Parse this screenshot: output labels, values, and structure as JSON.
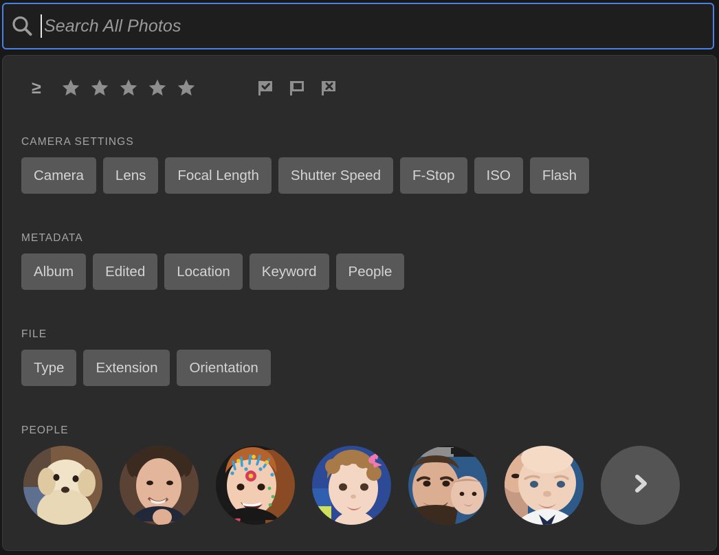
{
  "search": {
    "placeholder": "Search All Photos",
    "value": "",
    "icon": "search-icon"
  },
  "rating_filter": {
    "operator": "≥",
    "star_count": 5,
    "stars_selected": 0,
    "flags": [
      {
        "name": "flag-picked-icon",
        "label": "Picked"
      },
      {
        "name": "flag-unflagged-icon",
        "label": "Unflagged"
      },
      {
        "name": "flag-rejected-icon",
        "label": "Rejected"
      }
    ]
  },
  "sections": [
    {
      "title": "CAMERA SETTINGS",
      "chips": [
        "Camera",
        "Lens",
        "Focal Length",
        "Shutter Speed",
        "F-Stop",
        "ISO",
        "Flash"
      ]
    },
    {
      "title": "METADATA",
      "chips": [
        "Album",
        "Edited",
        "Location",
        "Keyword",
        "People"
      ]
    },
    {
      "title": "FILE",
      "chips": [
        "Type",
        "Extension",
        "Orientation"
      ]
    }
  ],
  "people": {
    "title": "PEOPLE",
    "avatars": [
      {
        "name": "avatar-dog",
        "alt": "white curly dog on brown couch"
      },
      {
        "name": "avatar-woman",
        "alt": "smiling woman with short brown hair"
      },
      {
        "name": "avatar-girl-facepaint",
        "alt": "girl with colorful face paint"
      },
      {
        "name": "avatar-toddler-girl",
        "alt": "toddler girl with pink hair clip"
      },
      {
        "name": "avatar-man-and-baby",
        "alt": "man with baby, blue background"
      },
      {
        "name": "avatar-baby-boy",
        "alt": "baby boy in white shirt"
      }
    ],
    "next_button": {
      "name": "people-next-button",
      "icon": "chevron-right-icon"
    }
  },
  "colors": {
    "page_background": "#181818",
    "panel_background": "#2b2b2b",
    "search_background": "#1e1e1e",
    "focus_border": "#4a80e8",
    "chip_background": "#585858",
    "chip_text": "#d4d4d4",
    "section_title": "#a5a5a5",
    "icon_gray": "#8e8e8e",
    "next_button_background": "#545454"
  }
}
